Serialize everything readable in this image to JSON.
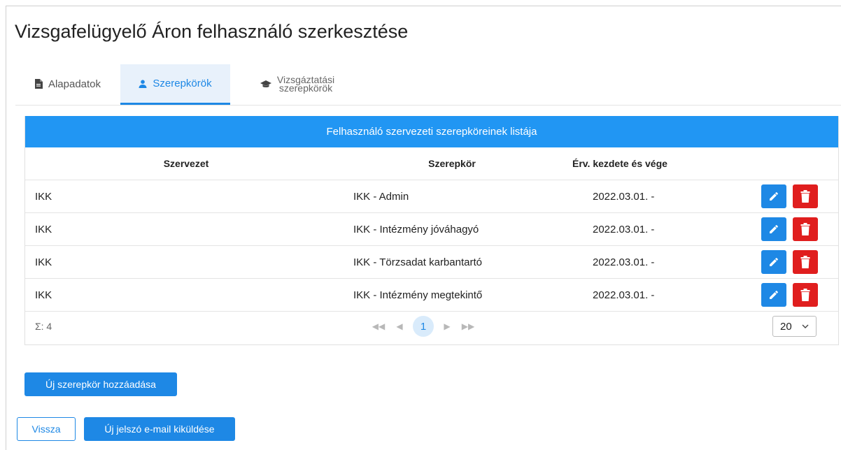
{
  "page": {
    "title": "Vizsgafelügyelő Áron felhasználó szerkesztése"
  },
  "tabs": [
    {
      "label": "Alapadatok",
      "icon": "document-icon"
    },
    {
      "label": "Szerepkörök",
      "icon": "user-icon"
    },
    {
      "label_line1": "Vizsgáztatási",
      "label_line2": "szerepkörök",
      "icon": "graduation-cap-icon"
    }
  ],
  "table": {
    "title": "Felhasználó szervezeti szerepköreinek listája",
    "columns": {
      "org": "Szervezet",
      "role": "Szerepkör",
      "validity": "Érv. kezdete és vége"
    },
    "rows": [
      {
        "org": "IKK",
        "role": "IKK - Admin",
        "validity": "2022.03.01. -"
      },
      {
        "org": "IKK",
        "role": "IKK - Intézmény jóváhagyó",
        "validity": "2022.03.01. -"
      },
      {
        "org": "IKK",
        "role": "IKK - Törzsadat karbantartó",
        "validity": "2022.03.01. -"
      },
      {
        "org": "IKK",
        "role": "IKK - Intézmény megtekintő",
        "validity": "2022.03.01. -"
      }
    ],
    "summary": "Σ: 4",
    "pager": {
      "first": "◀◀",
      "prev": "◀",
      "current": "1",
      "next": "▶",
      "last": "▶▶"
    },
    "page_size": "20"
  },
  "buttons": {
    "add_role": "Új szerepkör hozzáadása",
    "back": "Vissza",
    "send_password": "Új jelszó e-mail kiküldése"
  },
  "colors": {
    "primary": "#1e88e5",
    "header": "#2196f3",
    "danger": "#e01e1e",
    "tab_active_bg": "#e8f1fb"
  }
}
